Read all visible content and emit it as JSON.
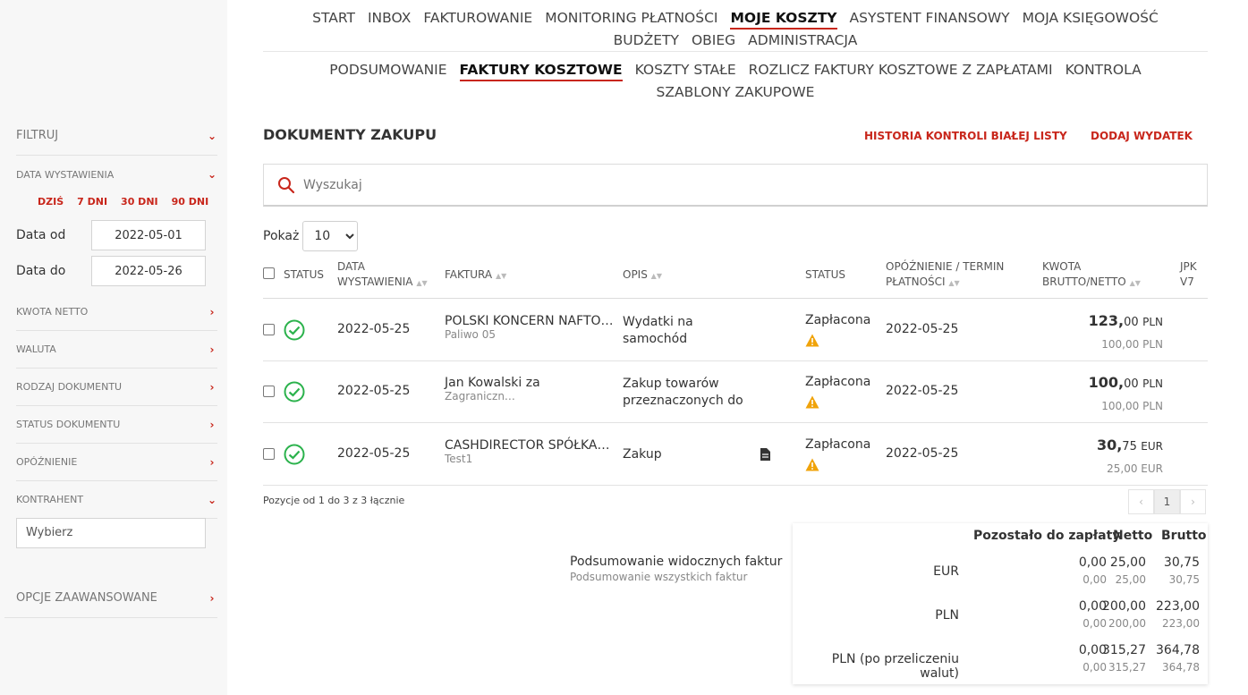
{
  "nav": {
    "items": [
      "START",
      "INBOX",
      "FAKTUROWANIE",
      "MONITORING PŁATNOŚCI",
      "MOJE KOSZTY",
      "ASYSTENT FINANSOWY",
      "MOJA KSIĘGOWOŚĆ",
      "BUDŻETY",
      "OBIEG",
      "ADMINISTRACJA"
    ],
    "active": "MOJE KOSZTY"
  },
  "subnav": {
    "items": [
      "PODSUMOWANIE",
      "FAKTURY KOSZTOWE",
      "KOSZTY STAŁE",
      "ROZLICZ FAKTURY KOSZTOWE Z ZAPŁATAMI",
      "KONTROLA",
      "SZABLONY ZAKUPOWE"
    ],
    "active": "FAKTURY KOSZTOWE"
  },
  "sidebar": {
    "filtruj": "FILTRUJ",
    "data_wystawienia": "DATA WYSTAWIENIA",
    "quick": [
      "DZIŚ",
      "7 DNI",
      "30 DNI",
      "90 DNI"
    ],
    "data_od_label": "Data od",
    "data_od_value": "2022-05-01",
    "data_do_label": "Data do",
    "data_do_value": "2022-05-26",
    "filters": [
      "KWOTA NETTO",
      "WALUTA",
      "RODZAJ DOKUMENTU",
      "STATUS DOKUMENTU",
      "OPÓŹNIENIE"
    ],
    "kontrahent": "KONTRAHENT",
    "wybierz": "Wybierz",
    "opcje": "OPCJE ZAAWANSOWANE"
  },
  "page": {
    "title": "DOKUMENTY ZAKUPU",
    "link_historia": "HISTORIA KONTROLI BIAŁEJ LISTY",
    "link_dodaj": "DODAJ WYDATEK",
    "search_placeholder": "Wyszukaj",
    "pokaz_label": "Pokaż",
    "pokaz_value": "10"
  },
  "table": {
    "headers": {
      "status": "STATUS",
      "data1": "DATA",
      "data2": "WYSTAWIENIA",
      "faktura": "FAKTURA",
      "opis": "OPIS",
      "status2": "STATUS",
      "termin1": "OPÓŹNIENIE / TERMIN",
      "termin2": "PŁATNOŚCI",
      "kwota1": "KWOTA",
      "kwota2": "BRUTTO/NETTO",
      "jpk1": "JPK",
      "jpk2": "V7"
    },
    "rows": [
      {
        "date": "2022-05-25",
        "faktura": "POLSKI KONCERN NAFTO…",
        "faktura_sub": "Paliwo 05",
        "opis1": "Wydatki na",
        "opis2": "samochód",
        "status": "Zapłacona",
        "termin": "2022-05-25",
        "brutto_int": "123,",
        "brutto_dec": "00",
        "netto": "100,00",
        "currency": "PLN",
        "has_doc": false
      },
      {
        "date": "2022-05-25",
        "faktura": "Jan Kowalski za",
        "faktura_sub": "Zagraniczn…",
        "opis1": "Zakup towarów",
        "opis2": "przeznaczonych do",
        "status": "Zapłacona",
        "termin": "2022-05-25",
        "brutto_int": "100,",
        "brutto_dec": "00",
        "netto": "100,00",
        "currency": "PLN",
        "has_doc": false
      },
      {
        "date": "2022-05-25",
        "faktura": "CASHDIRECTOR SPÓŁKA…",
        "faktura_sub": "Test1",
        "opis1": "Zakup",
        "opis2": "",
        "status": "Zapłacona",
        "termin": "2022-05-25",
        "brutto_int": "30,",
        "brutto_dec": "75",
        "netto": "25,00",
        "currency": "EUR",
        "has_doc": true
      }
    ],
    "pos_info": "Pozycje od 1 do 3 z 3 łącznie",
    "page": "1"
  },
  "summary": {
    "label_visible": "Podsumowanie widocznych faktur",
    "label_all": "Podsumowanie wszystkich faktur",
    "col_pozostalo": "Pozostało do zapłaty",
    "col_netto": "Netto",
    "col_brutto": "Brutto",
    "rows": [
      {
        "cur": "EUR",
        "poz": "0,00",
        "poz2": "0,00",
        "netto": "25,00",
        "netto2": "25,00",
        "brutto": "30,75",
        "brutto2": "30,75"
      },
      {
        "cur": "PLN",
        "poz": "0,00",
        "poz2": "0,00",
        "netto": "200,00",
        "netto2": "200,00",
        "brutto": "223,00",
        "brutto2": "223,00"
      },
      {
        "cur": "PLN (po przeliczeniu walut)",
        "poz": "0,00",
        "poz2": "0,00",
        "netto": "315,27",
        "netto2": "315,27",
        "brutto": "364,78",
        "brutto2": "364,78"
      }
    ]
  },
  "colors": {
    "accent": "#c8261b",
    "success": "#2bb24c",
    "warning": "#f0a30a"
  }
}
